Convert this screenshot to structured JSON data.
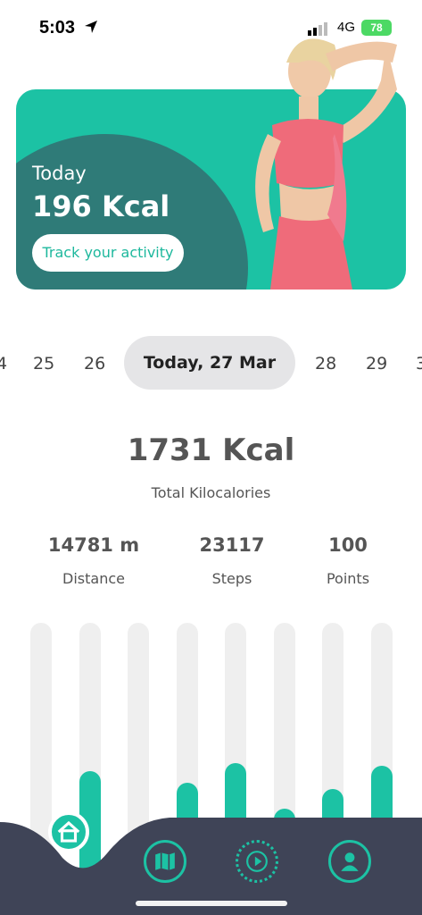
{
  "status": {
    "time": "5:03",
    "network": "4G",
    "battery": "78"
  },
  "hero": {
    "today_label": "Today",
    "kcal": "196 Kcal",
    "button_label": "Track your activity"
  },
  "dates": {
    "d24": "4",
    "d25": "25",
    "d26": "26",
    "today": "Today, 27 Mar",
    "d28": "28",
    "d29": "29",
    "d30": "3"
  },
  "summary": {
    "total": "1731 Kcal",
    "total_label": "Total Kilocalories"
  },
  "stats": [
    {
      "value": "14781 m",
      "label": "Distance"
    },
    {
      "value": "23117",
      "label": "Steps"
    },
    {
      "value": "100",
      "label": "Points"
    }
  ],
  "chart_data": {
    "type": "bar",
    "values": [
      0.2,
      0.48,
      0.27,
      0.44,
      0.51,
      0.35,
      0.42,
      0.5
    ],
    "ylim": [
      0,
      1
    ],
    "colors": {
      "fill": "#1cc2a4",
      "track": "#efefef"
    }
  },
  "nav": {
    "items": [
      "home-icon",
      "map-icon",
      "play-icon",
      "profile-icon"
    ]
  },
  "colors": {
    "accent": "#1cc2a4",
    "hero_dark": "#2f7b78",
    "nav_bg": "#3f4457"
  }
}
